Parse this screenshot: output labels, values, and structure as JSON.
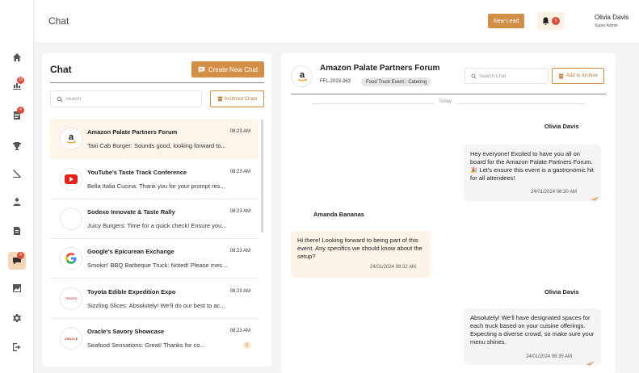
{
  "header": {
    "title": "Chat",
    "new_lead_label": "New Lead",
    "notification_count": "5",
    "user_name": "Olivia Davis",
    "user_role": "Super Admin"
  },
  "sidebar": {
    "items": [
      {
        "icon": "home-icon"
      },
      {
        "icon": "leads-icon",
        "badge": "10"
      },
      {
        "icon": "documents-icon",
        "badge": "4"
      },
      {
        "icon": "trophy-icon"
      },
      {
        "icon": "tools-icon"
      },
      {
        "icon": "users-icon"
      },
      {
        "icon": "invoice-icon"
      },
      {
        "icon": "chat-icon",
        "badge": "4",
        "active": true
      },
      {
        "icon": "reports-icon"
      },
      {
        "icon": "settings-icon"
      },
      {
        "icon": "logout-icon"
      }
    ]
  },
  "chat_list": {
    "title": "Chat",
    "create_label": "Create New Chat",
    "search_placeholder": "Search",
    "archived_label": "Archived Chats",
    "items": [
      {
        "name": "Amazon Palate Partners Forum",
        "time": "08:23 AM",
        "preview": "Taxi Cab Burger: Sounds good, looking forward to...",
        "logo": "amazon-logo"
      },
      {
        "name": "YouTube's Taste Track Conference",
        "time": "08:23 AM",
        "preview": "Bella Italia Cucina: Thank you for your prompt res...",
        "logo": "youtube-logo"
      },
      {
        "name": "Sodexo Innovate & Taste Rally",
        "time": "08:23 AM",
        "preview": "Juicy Burgers: Time for a quick check! Ensure you...",
        "logo": "sodexo-logo"
      },
      {
        "name": "Google's Epicurean Exchange",
        "time": "08:23 AM",
        "preview": " Smokin' BBQ Barbeque Truck: Noted! Please mes...",
        "logo": "google-logo"
      },
      {
        "name": "Toyota Edible Expedition Expo",
        "time": "08:23 AM",
        "preview": "Sizzling Slices: Absolutely! We'll do our best to ac...",
        "logo": "toyota-logo",
        "logo_text": "TOYOTA"
      },
      {
        "name": "Oracle's Savory Showcase",
        "time": "08:23 AM",
        "preview": "Seafood Sensations: Great! Thanks for co...",
        "logo": "oracle-logo",
        "logo_text": "ORACLE",
        "unread": "2"
      }
    ]
  },
  "conversation": {
    "title": "Amazon Palate Partners Forum",
    "code": "FFL-2023-363",
    "tag": "Food Truck Event - Catering",
    "search_placeholder": "Search Chat",
    "archive_label": "Add to Archive",
    "day_label": "Today",
    "messages": [
      {
        "sender": "Olivia Davis",
        "text": "Hey everyone! Excited to have you all on board for the Amazon Palate Partners Forum. 🎉 Let's ensure this event is a gastronomic hit for all attendees!",
        "time": "24/01/2024 08:30 AM",
        "direction": "out"
      },
      {
        "sender": "Amanda Bananas",
        "text": "Hi there! Looking forward to being part of this event. Any specifics we should know about the setup?",
        "time": "24/01/2024 08:32 AM",
        "direction": "in"
      },
      {
        "sender": "Olivia Davis",
        "text": "Absolutely! We'll have designated spaces for each truck based on your cuisine offerings. Expecting a diverse crowd, so make sure your menu shines.",
        "time": "24/01/2024 08:35 AM",
        "direction": "out"
      }
    ]
  },
  "colors": {
    "accent": "#d38f45",
    "badge": "#e04a3a",
    "selected_row": "#fdf5ea"
  }
}
